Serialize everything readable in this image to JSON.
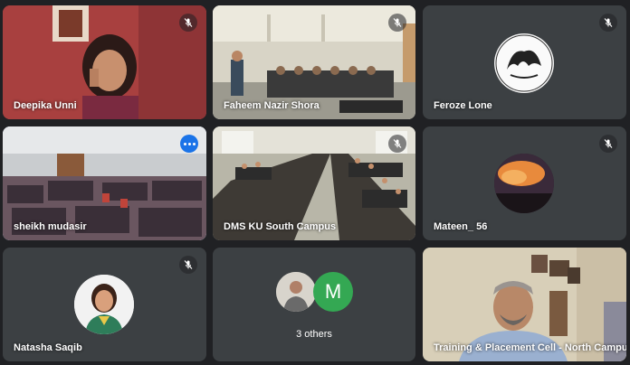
{
  "tiles": [
    {
      "name": "Deepika Unni"
    },
    {
      "name": "Faheem Nazir Shora"
    },
    {
      "name": "Feroze Lone"
    },
    {
      "name": "sheikh mudasir"
    },
    {
      "name": "DMS KU South Campus"
    },
    {
      "name": "Mateen_ 56"
    },
    {
      "name": "Natasha Saqib"
    },
    {
      "name": "3 others",
      "letter": "M"
    },
    {
      "name": "Training & Placement Cell - North Campus"
    }
  ],
  "colors": {
    "background": "#202124",
    "tile": "#3c4043",
    "active_border": "#8ab4f8",
    "more_button": "#1a73e8",
    "avatar_m": "#34a853"
  },
  "icons": {
    "muted": "mic-off-icon",
    "more": "more-options-icon"
  }
}
